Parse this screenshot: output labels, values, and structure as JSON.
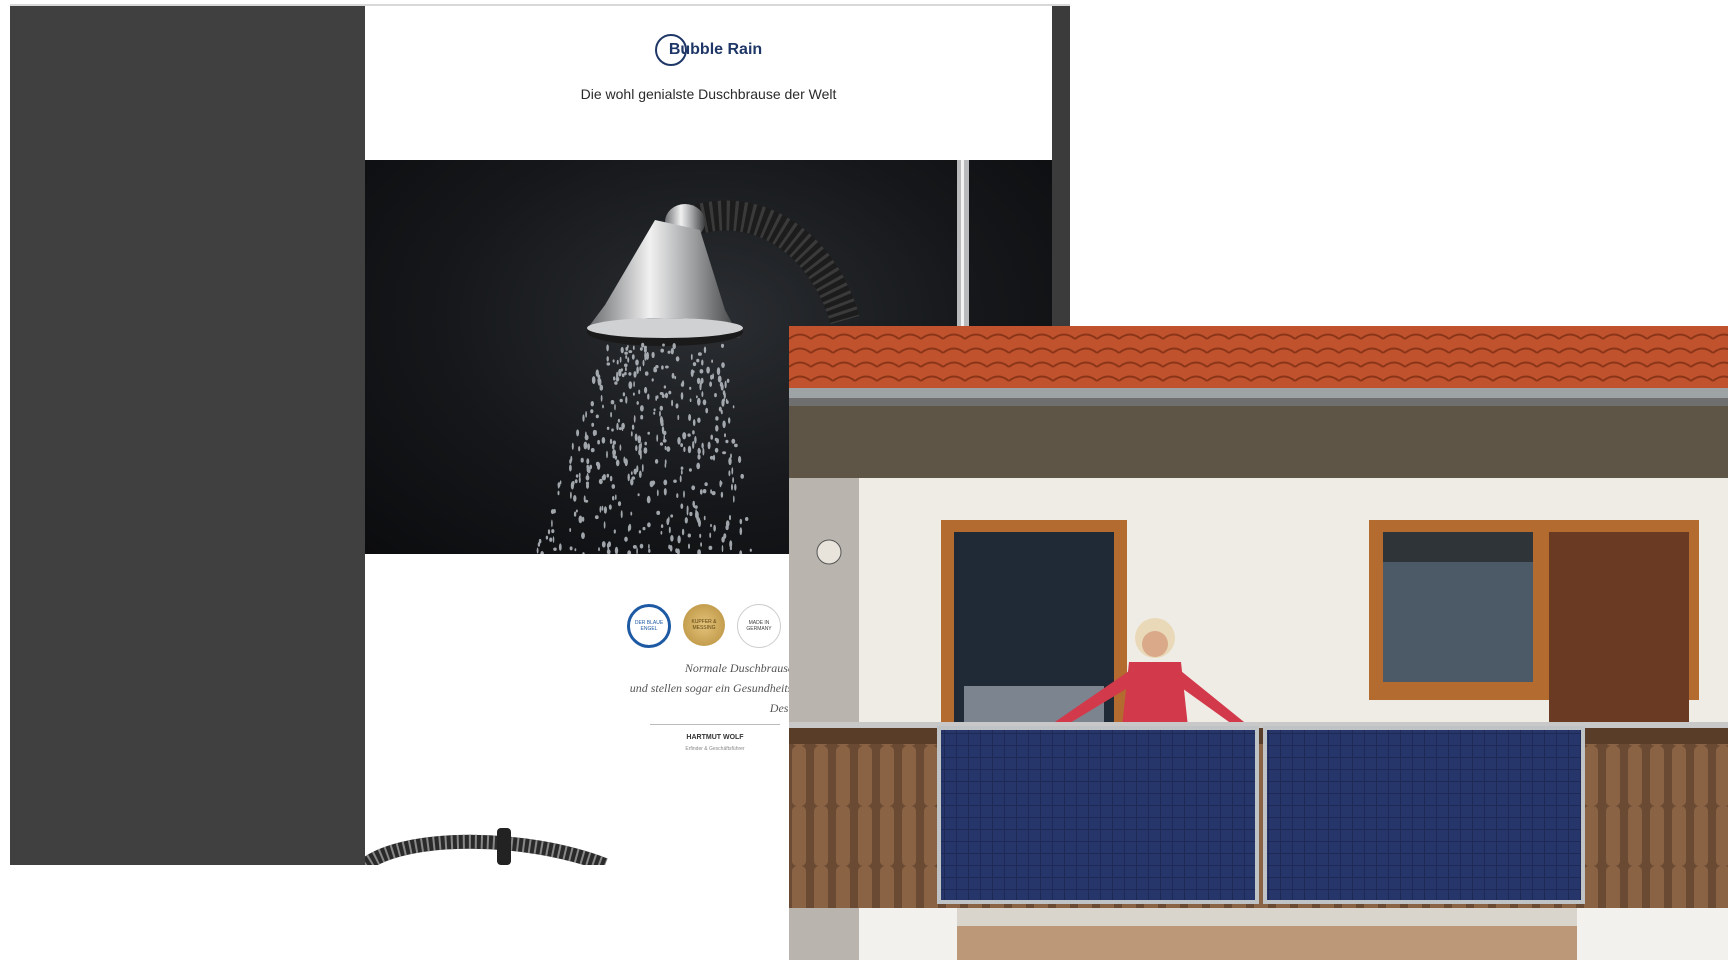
{
  "viewer": {
    "logo_text": "Bubble Rain",
    "tagline": "Die wohl genialste Duschbrause der Welt",
    "badges": [
      {
        "text": "DER BLAUE ENGEL",
        "icon": "blue-angel-icon"
      },
      {
        "text": "KUPFER & MESSING",
        "icon": "gold-seal-icon"
      },
      {
        "text": "MADE IN GERMANY",
        "icon": "made-in-germany-icon"
      }
    ],
    "quote_lines": [
      "Normale Duschbrausen verbrauchen viel Wasser und Energie,",
      "und stellen sogar ein Gesundheitsrisiko dar. Diese Eigenschaften sollen w",
      "Deshalb haben wir die aktiven Wasserblasen"
    ],
    "signer_name": "HARTMUT WOLF",
    "signer_role": "Erfinder & Geschäftsführer"
  },
  "colors": {
    "viewer_bg": "#404040",
    "brand_blue": "#1f3766",
    "roof_tile": "#c0522e",
    "panel_blue": "#1e2a55"
  }
}
